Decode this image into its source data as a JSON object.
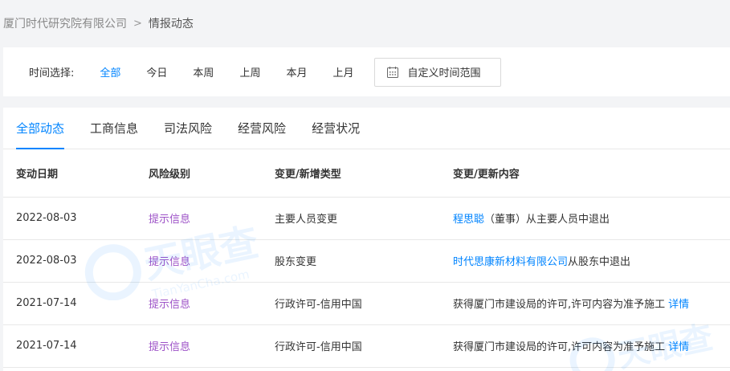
{
  "breadcrumb": {
    "company": "厦门时代研究院有限公司",
    "separator": ">",
    "current": "情报动态"
  },
  "filter": {
    "label": "时间选择:",
    "options": [
      "全部",
      "今日",
      "本周",
      "上周",
      "本月",
      "上月"
    ],
    "active_index": 0,
    "custom_range_label": "自定义时间范围"
  },
  "tabs": [
    {
      "label": "全部动态",
      "active": true
    },
    {
      "label": "工商信息",
      "active": false
    },
    {
      "label": "司法风险",
      "active": false
    },
    {
      "label": "经营风险",
      "active": false
    },
    {
      "label": "经营状况",
      "active": false
    }
  ],
  "table": {
    "headers": [
      "变动日期",
      "风险级别",
      "变更/新增类型",
      "变更/更新内容"
    ],
    "rows": [
      {
        "date": "2022-08-03",
        "risk": "提示信息",
        "type": "主要人员变更",
        "content_link": "程思聪",
        "content_text": "（董事）从主要人员中退出",
        "detail": ""
      },
      {
        "date": "2022-08-03",
        "risk": "提示信息",
        "type": "股东变更",
        "content_link": "时代思康新材料有限公司",
        "content_text": "从股东中退出",
        "detail": ""
      },
      {
        "date": "2021-07-14",
        "risk": "提示信息",
        "type": "行政许可-信用中国",
        "content_link": "",
        "content_text": "获得厦门市建设局的许可,许可内容为准予施工",
        "detail": "详情"
      },
      {
        "date": "2021-07-14",
        "risk": "提示信息",
        "type": "行政许可-信用中国",
        "content_link": "",
        "content_text": "获得厦门市建设局的许可,许可内容为准予施工",
        "detail": "详情"
      }
    ]
  },
  "watermark": {
    "text": "天眼查",
    "subtext": "TianYanCha.com"
  },
  "colors": {
    "accent": "#0084ff",
    "risk_tip": "#9d52c7",
    "background": "#f3f4f6"
  }
}
